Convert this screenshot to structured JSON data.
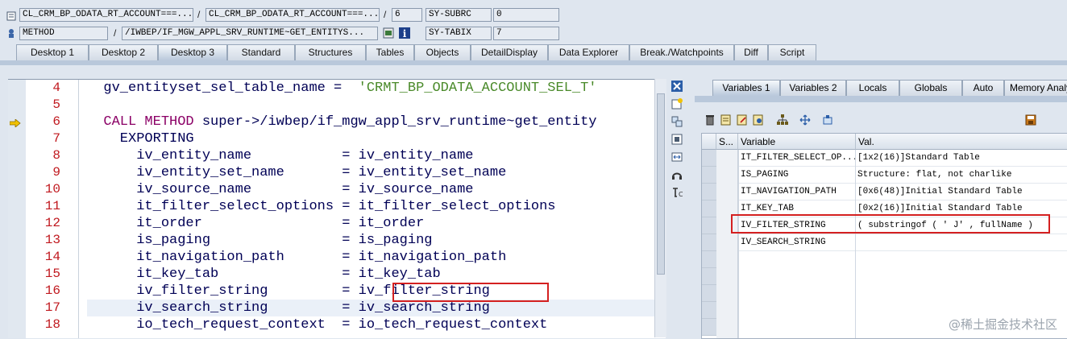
{
  "top": {
    "row1": {
      "program": "CL_CRM_BP_ODATA_RT_ACCOUNT===...",
      "include": "CL_CRM_BP_ODATA_RT_ACCOUNT===...",
      "line": "6",
      "sysvar1": "SY-SUBRC",
      "sysval1": "0"
    },
    "row2": {
      "event_type": "METHOD",
      "event": "/IWBEP/IF_MGW_APPL_SRV_RUNTIME~GET_ENTITYS...",
      "sysvar2": "SY-TABIX",
      "sysval2": "7"
    },
    "separator": "/"
  },
  "tabs": [
    "Desktop 1",
    "Desktop 2",
    "Desktop 3",
    "Standard",
    "Structures",
    "Tables",
    "Objects",
    "DetailDisplay",
    "Data Explorer",
    "Break./Watchpoints",
    "Diff",
    "Script"
  ],
  "active_tab": "Desktop 3",
  "code": {
    "lines": [
      {
        "num": "4",
        "text": "  gv_entityset_sel_table_name =  'CRMT_BP_ODATA_ACCOUNT_SEL_T'"
      },
      {
        "num": "5",
        "text": ""
      },
      {
        "num": "6",
        "text": "  CALL METHOD super->/iwbep/if_mgw_appl_srv_runtime~get_entity"
      },
      {
        "num": "7",
        "text": "    EXPORTING"
      },
      {
        "num": "8",
        "text": "      iv_entity_name           = iv_entity_name"
      },
      {
        "num": "9",
        "text": "      iv_entity_set_name       = iv_entity_set_name"
      },
      {
        "num": "10",
        "text": "      iv_source_name           = iv_source_name"
      },
      {
        "num": "11",
        "text": "      it_filter_select_options = it_filter_select_options"
      },
      {
        "num": "12",
        "text": "      it_order                 = it_order"
      },
      {
        "num": "13",
        "text": "      is_paging                = is_paging"
      },
      {
        "num": "14",
        "text": "      it_navigation_path       = it_navigation_path"
      },
      {
        "num": "15",
        "text": "      it_key_tab               = it_key_tab"
      },
      {
        "num": "16",
        "text": "      iv_filter_string         = iv_filter_string"
      },
      {
        "num": "17",
        "text": "      iv_search_string         = iv_search_string"
      },
      {
        "num": "18",
        "text": "      io_tech_request_context  = io_tech_request_context"
      }
    ],
    "current_line": "6"
  },
  "right_tabs": [
    "Variables 1",
    "Variables 2",
    "Locals",
    "Globals",
    "Auto",
    "Memory Analy"
  ],
  "variables": {
    "headers": {
      "sel": "S...",
      "variable": "Variable",
      "value": "Val."
    },
    "rows": [
      {
        "variable": "IT_FILTER_SELECT_OP...",
        "value": "[1x2(16)]Standard Table"
      },
      {
        "variable": "IS_PAGING",
        "value": "Structure: flat, not charlike"
      },
      {
        "variable": "IT_NAVIGATION_PATH",
        "value": "[0x6(48)]Initial Standard Table"
      },
      {
        "variable": "IT_KEY_TAB",
        "value": "[0x2(16)]Initial Standard Table"
      },
      {
        "variable": "IV_FILTER_STRING",
        "value": "( substringof ( ' J' , fullName )"
      },
      {
        "variable": "IV_SEARCH_STRING",
        "value": ""
      }
    ]
  },
  "watermark": "@稀土掘金技术社区"
}
